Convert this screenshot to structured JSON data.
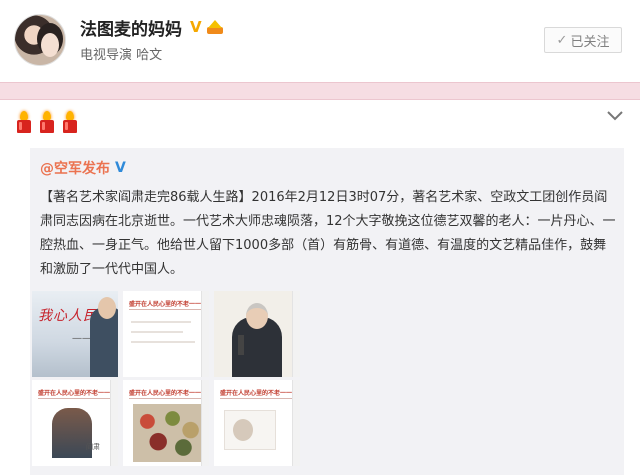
{
  "profile": {
    "name": "法图麦的妈妈",
    "verify_mark": "V",
    "title": "电视导演 哈文",
    "follow_label": "已关注",
    "check_mark": "✓"
  },
  "post": {
    "repost": {
      "author": "@空军发布",
      "verify_mark": "V",
      "text": "【著名艺术家阎肃走完86载人生路】2016年2月12日3时07分，著名艺术家、空政文工团创作员阎肃同志因病在北京逝世。一代艺术大师忠魂陨落，12个大字敬挽这位德艺双馨的老人：一片丹心、一腔热血、一身正气。他给世人留下1000多部（首）有筋骨、有道德、有温度的文艺精品佳作，鼓舞和激励了一代代中国人。"
    },
    "thumbnails": [
      {
        "caption": "我心人民满家",
        "subcaption": "——阎肃"
      },
      {
        "header": "盛开在人民心里的不老一一阎肃"
      },
      {
        "header": ""
      },
      {
        "header": "盛开在人民心里的不老一一阎肃",
        "signature": "阎肃"
      },
      {
        "header": "盛开在人民心里的不老一一阎肃"
      },
      {
        "header": "盛开在人民心里的不老一一阎肃"
      }
    ]
  },
  "colors": {
    "accent_orange": "#eb7350",
    "verify_yellow": "#f5a800",
    "verify_blue": "#2f8ad9",
    "pink_bar": "#f6dde3",
    "repost_bg": "#f2f2f5"
  },
  "icons": [
    "candle-icon",
    "candle-icon",
    "candle-icon",
    "chevron-down-icon",
    "check-icon",
    "crown-icon"
  ]
}
